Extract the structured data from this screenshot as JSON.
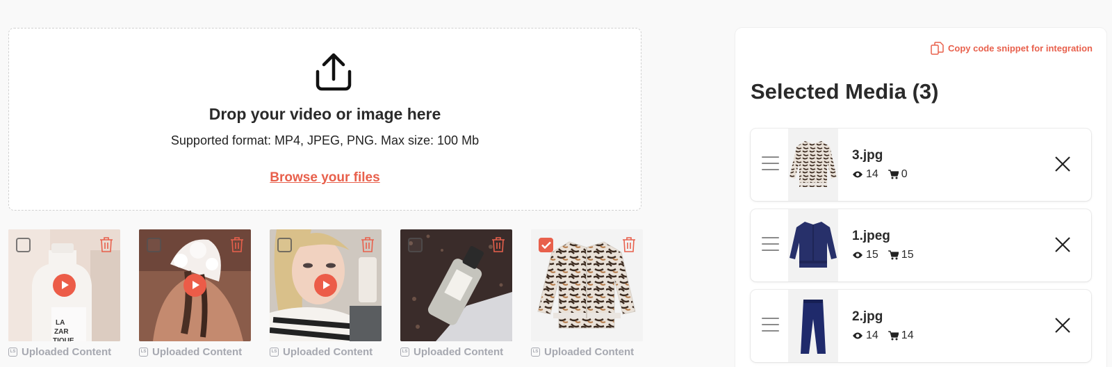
{
  "upload": {
    "title": "Drop your video or image here",
    "subtitle": "Supported format: MP4, JPEG, PNG. Max size: 100 Mb",
    "browse_label": "Browse your files",
    "icon": "upload-icon"
  },
  "gallery": {
    "items": [
      {
        "label": "Uploaded Content",
        "badge": "LS",
        "type": "video",
        "checked": false
      },
      {
        "label": "Uploaded Content",
        "badge": "LS",
        "type": "video",
        "checked": false
      },
      {
        "label": "Uploaded Content",
        "badge": "LS",
        "type": "video",
        "checked": false
      },
      {
        "label": "Uploaded Content",
        "badge": "LS",
        "type": "image",
        "checked": false
      },
      {
        "label": "Uploaded Content",
        "badge": "LS",
        "type": "image",
        "checked": true
      }
    ]
  },
  "panel": {
    "copy_label": "Copy code snippet for integration",
    "title": "Selected Media (3)",
    "items": [
      {
        "name": "3.jpg",
        "views": "14",
        "carts": "0"
      },
      {
        "name": "1.jpeg",
        "views": "15",
        "carts": "15"
      },
      {
        "name": "2.jpg",
        "views": "14",
        "carts": "14"
      }
    ]
  },
  "colors": {
    "accent": "#e8604c",
    "muted": "#a6a8b0",
    "text": "#2a2a2a"
  }
}
